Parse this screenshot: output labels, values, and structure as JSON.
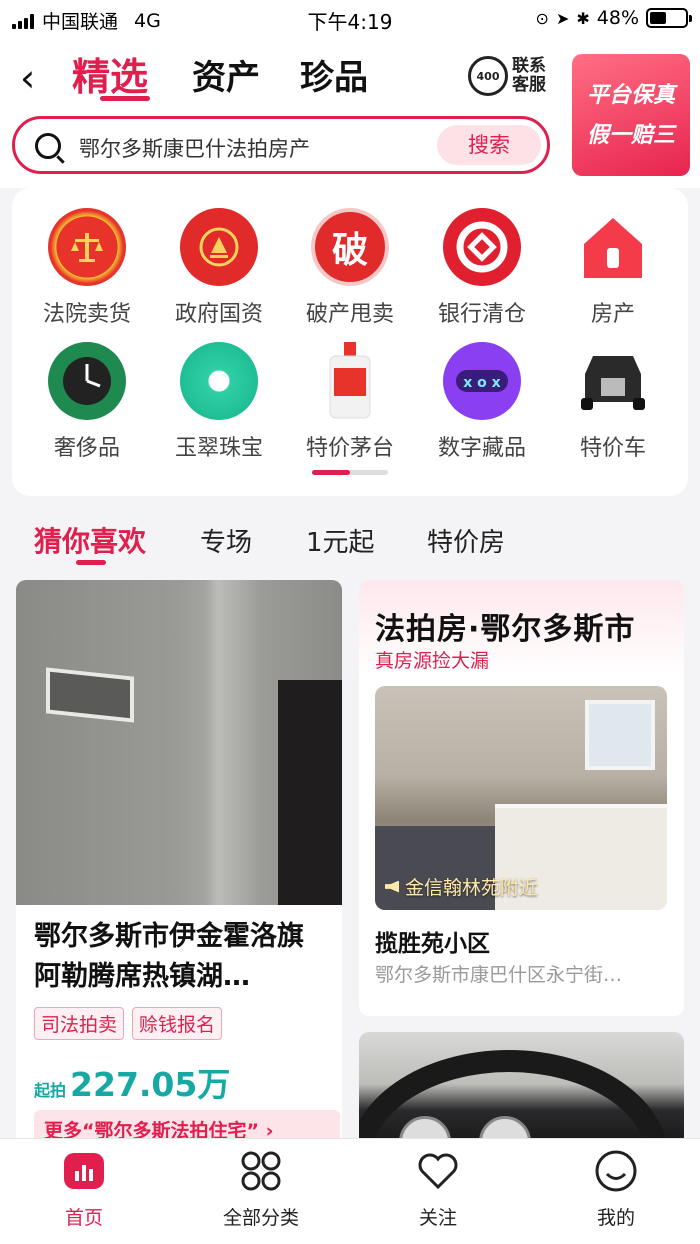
{
  "status_bar": {
    "carrier": "中国联通",
    "network": "4G",
    "time": "下午4:19",
    "battery": "48%",
    "battery_level": 0.48
  },
  "header": {
    "tabs": [
      {
        "label": "精选",
        "active": true
      },
      {
        "label": "资产",
        "active": false
      },
      {
        "label": "珍品",
        "active": false
      }
    ],
    "customer_service": {
      "badge": "400",
      "label": "联系客服"
    },
    "guarantee": {
      "line1": "平台保真",
      "line2": "假一赔三"
    },
    "search": {
      "value": "鄂尔多斯康巴什法拍房产",
      "button": "搜索"
    }
  },
  "categories": [
    {
      "label": "法院卖货",
      "icon": "court-emblem-icon"
    },
    {
      "label": "政府国资",
      "icon": "government-emblem-icon"
    },
    {
      "label": "破产甩卖",
      "icon": "bankruptcy-icon",
      "glyph": "破"
    },
    {
      "label": "银行清仓",
      "icon": "bank-icon"
    },
    {
      "label": "房产",
      "icon": "house-icon"
    },
    {
      "label": "奢侈品",
      "icon": "watch-icon"
    },
    {
      "label": "玉翠珠宝",
      "icon": "jade-pendant-icon"
    },
    {
      "label": "特价茅台",
      "icon": "liquor-bottle-icon"
    },
    {
      "label": "数字藏品",
      "icon": "digital-collectible-icon"
    },
    {
      "label": "特价车",
      "icon": "car-icon"
    }
  ],
  "feed_tabs": [
    {
      "label": "猜你喜欢",
      "active": true
    },
    {
      "label": "专场"
    },
    {
      "label": "1元起"
    },
    {
      "label": "特价房"
    }
  ],
  "listing_left": {
    "title": "鄂尔多斯市伊金霍洛旗阿勒腾席热镇湖…",
    "tags": [
      "司法拍卖",
      "赊钱报名"
    ],
    "price_label": "起拍",
    "price": "227.05万",
    "more_link": "更多“鄂尔多斯法拍住宅” ›"
  },
  "listing_right": {
    "title": "法拍房·鄂尔多斯市",
    "subtitle": "真房源捡大漏",
    "location": "金信翰林苑附近",
    "name": "揽胜苑小区",
    "address": "鄂尔多斯市康巴什区永宁街…"
  },
  "tabbar": [
    {
      "label": "首页",
      "active": true,
      "icon": "home-icon"
    },
    {
      "label": "全部分类",
      "active": false,
      "icon": "grid-icon"
    },
    {
      "label": "关注",
      "active": false,
      "icon": "heart-icon"
    },
    {
      "label": "我的",
      "active": false,
      "icon": "smile-icon"
    }
  ],
  "colors": {
    "accent": "#e01f4f",
    "price": "#17a8a3"
  }
}
